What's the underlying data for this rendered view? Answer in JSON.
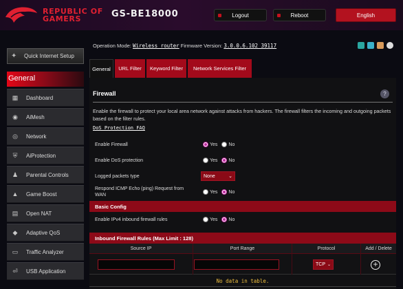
{
  "header": {
    "brand_line1": "REPUBLIC OF",
    "brand_line2": "GAMERS",
    "model": "GS-BE18000",
    "logout_label": "Logout",
    "reboot_label": "Reboot",
    "language": "English"
  },
  "info": {
    "op_mode_label": "Operation Mode:",
    "op_mode_value": "Wireless router",
    "firmware_label": "Firmware Version:",
    "firmware_value": "3.0.0.6.102_39117"
  },
  "sidebar": {
    "quick_setup": "Quick Internet Setup",
    "section_label": "General",
    "items": [
      {
        "label": "Dashboard",
        "icon": "dashboard-icon"
      },
      {
        "label": "AiMesh",
        "icon": "mesh-icon"
      },
      {
        "label": "Network",
        "icon": "network-icon"
      },
      {
        "label": "AiProtection",
        "icon": "shield-icon"
      },
      {
        "label": "Parental Controls",
        "icon": "family-icon"
      },
      {
        "label": "Game Boost",
        "icon": "gamepad-icon"
      },
      {
        "label": "Open NAT",
        "icon": "nat-icon"
      },
      {
        "label": "Adaptive QoS",
        "icon": "qos-icon"
      },
      {
        "label": "Traffic Analyzer",
        "icon": "analyzer-icon"
      },
      {
        "label": "USB Application",
        "icon": "usb-icon"
      }
    ]
  },
  "tabs": [
    {
      "label": "General",
      "active": true
    },
    {
      "label": "URL Filter",
      "active": false
    },
    {
      "label": "Keyword Filter",
      "active": false
    },
    {
      "label": "Network Services Filter",
      "active": false
    }
  ],
  "firewall": {
    "title": "Firewall",
    "description": "Enable the firewall to protect your local area network against attacks from hackers. The firewall filters the incoming and outgoing packets based on the filter rules.",
    "faq_link": "DoS Protection FAQ",
    "yes": "Yes",
    "no": "No",
    "enable_firewall_label": "Enable Firewall",
    "enable_dos_label": "Enable DoS protection",
    "logged_packets_label": "Logged packets type",
    "logged_packets_value": "None",
    "icmp_label_line1": "Respond ICMP Echo (ping) Request from",
    "icmp_label_line2": "WAN",
    "basic_config_label": "Basic Config",
    "ipv4_inbound_label": "Enable IPv4 inbound firewall rules",
    "inbound_rules_title": "Inbound Firewall Rules (Max Limit : 128)",
    "table_headers": [
      "Source IP",
      "Port Range",
      "Protocol",
      "Add / Delete"
    ],
    "protocol_value": "TCP",
    "no_data": "No data in table."
  },
  "colors": {
    "accent": "#a30a1b",
    "radio_selected": "#c026a0",
    "no_data_text": "#f0c040"
  }
}
